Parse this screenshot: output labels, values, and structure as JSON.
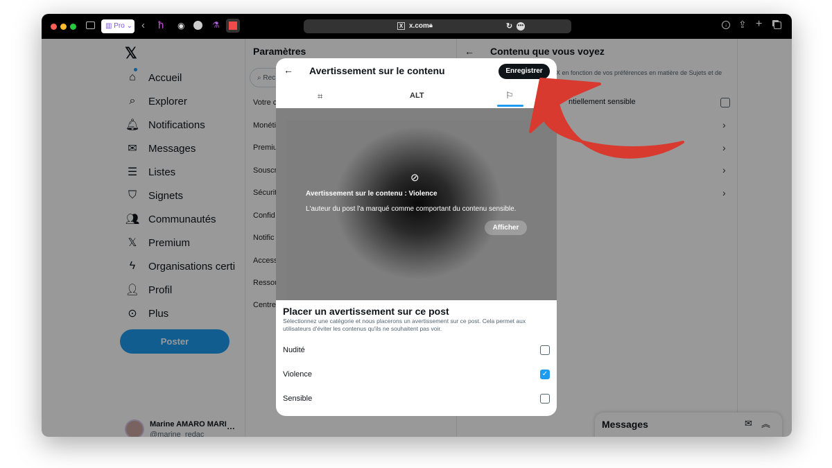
{
  "browser": {
    "url": "x.com",
    "extension_label": "Pro"
  },
  "sidebar": {
    "items": [
      {
        "label": "Accueil",
        "icon": "home-icon"
      },
      {
        "label": "Explorer",
        "icon": "search-icon"
      },
      {
        "label": "Notifications",
        "icon": "bell-icon"
      },
      {
        "label": "Messages",
        "icon": "mail-icon"
      },
      {
        "label": "Listes",
        "icon": "list-icon"
      },
      {
        "label": "Signets",
        "icon": "bookmark-icon"
      },
      {
        "label": "Communautés",
        "icon": "people-icon"
      },
      {
        "label": "Premium",
        "icon": "x-logo-icon"
      },
      {
        "label": "Organisations certi",
        "icon": "lightning-icon"
      },
      {
        "label": "Profil",
        "icon": "person-icon"
      },
      {
        "label": "Plus",
        "icon": "more-circle-icon"
      }
    ],
    "post_button": "Poster",
    "user": {
      "name": "Marine AMARO MARI",
      "handle": "@marine_redac"
    }
  },
  "settings": {
    "title": "Paramètres",
    "search_placeholder": "Rec",
    "items": [
      "Votre c",
      "Monéti",
      "Premiu",
      "Souscr",
      "Sécurit",
      "Confid",
      "Notific",
      "Access",
      "Ressou",
      "Centre"
    ]
  },
  "right": {
    "title": "Contenu que vous voyez",
    "description": "X en fonction de vos préférences en matière de Sujets et de",
    "sensitive_label": "ntiellement sensible"
  },
  "modal": {
    "title": "Avertissement sur le contenu",
    "save_button": "Enregistrer",
    "tabs": [
      {
        "icon": "crop-icon"
      },
      {
        "label": "ALT"
      },
      {
        "icon": "flag-icon",
        "active": true
      }
    ],
    "preview": {
      "warning_title": "Avertissement sur le contenu : Violence",
      "warning_text": "L'auteur du post l'a marqué comme comportant du contenu sensible.",
      "show_button": "Afficher"
    },
    "section_title": "Placer un avertissement sur ce post",
    "section_desc": "Sélectionnez une catégorie et nous placerons un avertissement sur ce post. Cela permet aux utilisateurs d'éviter les contenus qu'ils ne souhaitent pas voir.",
    "options": [
      {
        "label": "Nudité",
        "checked": false
      },
      {
        "label": "Violence",
        "checked": true
      },
      {
        "label": "Sensible",
        "checked": false
      }
    ]
  },
  "messages_drawer": {
    "title": "Messages"
  },
  "colors": {
    "accent": "#1d9bf0",
    "annotation_arrow": "#d93a2f",
    "save_button": "#0f1419"
  }
}
